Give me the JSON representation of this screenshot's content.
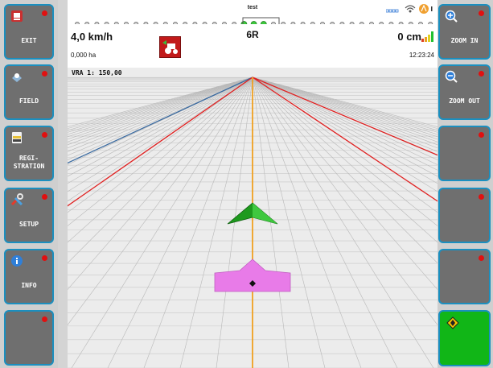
{
  "left_buttons": [
    {
      "label": "EXIT",
      "icon": "exit-icon"
    },
    {
      "label": "FIELD",
      "icon": "field-icon"
    },
    {
      "label": "REGI-\nSTRATION",
      "icon": "registration-icon"
    },
    {
      "label": "SETUP",
      "icon": "setup-icon"
    },
    {
      "label": "INFO",
      "icon": "info-icon"
    },
    {
      "label": "",
      "icon": ""
    }
  ],
  "right_buttons": [
    {
      "label": "ZOOM IN",
      "icon": "zoom-in-icon"
    },
    {
      "label": "ZOOM OUT",
      "icon": "zoom-out-icon"
    },
    {
      "label": "",
      "icon": ""
    },
    {
      "label": "",
      "icon": ""
    },
    {
      "label": "",
      "icon": ""
    },
    {
      "label": "",
      "icon": "autopilot-diamond-icon",
      "color": "#11b617"
    }
  ],
  "status": {
    "speed": "4,0 km/h",
    "area": "0,000 ha",
    "profile": "test",
    "track": "6R",
    "offset": "0 cm",
    "time": "12:23:24",
    "vra": "VRA 1:  150,00"
  },
  "colors": {
    "button_fill": "#6f6f6f",
    "button_border": "#1b8fbf",
    "indicator": "#e01010",
    "guidance_line": "#f0a020",
    "track_lines": "#e02020",
    "machine": "#e87be8",
    "arrow": "#1e9a1e"
  }
}
